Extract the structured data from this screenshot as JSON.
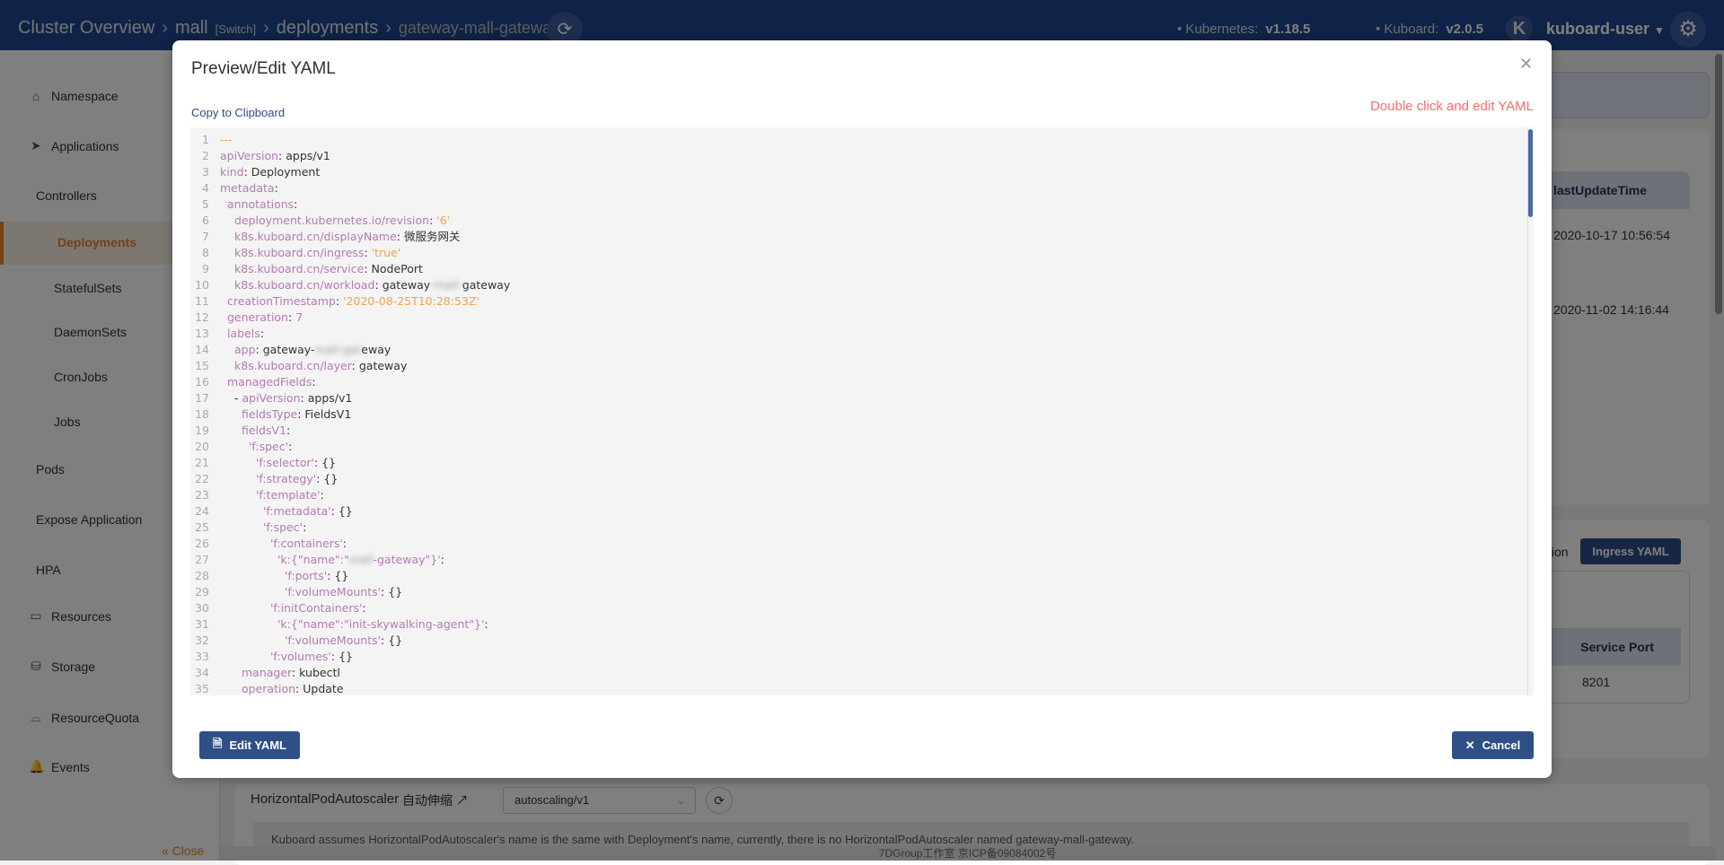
{
  "header": {
    "breadcrumb": [
      "Cluster Overview",
      "mall",
      "[Switch]",
      "deployments",
      "gateway-mall-gateway"
    ],
    "k8s_label": "Kubernetes:",
    "k8s_version": "v1.18.5",
    "kuboard_label": "Kuboard:",
    "kuboard_version": "v2.0.5",
    "avatar": "K",
    "user": "kuboard-user"
  },
  "sidebar": {
    "items": [
      {
        "label": "Namespace",
        "icon": "home"
      },
      {
        "label": "Applications",
        "icon": "paper-plane"
      },
      {
        "label": "Controllers"
      },
      {
        "label": "Deployments",
        "active": true
      },
      {
        "label": "StatefulSets"
      },
      {
        "label": "DaemonSets"
      },
      {
        "label": "CronJobs"
      },
      {
        "label": "Jobs"
      },
      {
        "label": "Pods"
      },
      {
        "label": "Expose Application"
      },
      {
        "label": "HPA"
      },
      {
        "label": "Resources",
        "icon": "layers"
      },
      {
        "label": "Storage",
        "icon": "database"
      },
      {
        "label": "ResourceQuota",
        "icon": "bell-cover"
      },
      {
        "label": "Events",
        "icon": "bell"
      }
    ],
    "close": "« Close"
  },
  "background": {
    "col_last_update": "lastUpdateTime",
    "rows": [
      "2020-10-17 10:56:54",
      "2020-11-02 14:16:44"
    ],
    "partial": "tion",
    "ingress_yaml": "Ingress YAML",
    "col_service_port": "Service Port",
    "service_port": "8201",
    "hpa_label": "HorizontalPodAutoscaler",
    "hpa_cn": "自动伸缩",
    "hpa_select": "autoscaling/v1",
    "hpa_info": "Kuboard assumes HorizontalPodAutoscaler's name is the same with Deployment's name, currently, there is no HorizontalPodAutoscaler named gateway-mall-gateway.",
    "footer": "7DGroup工作室     京ICP备09084002号"
  },
  "modal": {
    "title": "Preview/Edit YAML",
    "copy": "Copy to Clipboard",
    "hint": "Double click and edit YAML",
    "edit_button": "Edit YAML",
    "cancel_button": "Cancel",
    "yaml": [
      {
        "i": 0,
        "raw": "---"
      },
      {
        "i": 0,
        "k": "apiVersion",
        "v": "apps/v1"
      },
      {
        "i": 0,
        "k": "kind",
        "v": "Deployment"
      },
      {
        "i": 0,
        "k": "metadata"
      },
      {
        "i": 2,
        "k": "annotations"
      },
      {
        "i": 4,
        "k": "deployment.kubernetes.io/revision",
        "v": "'6'",
        "s": true
      },
      {
        "i": 4,
        "k": "k8s.kuboard.cn/displayName",
        "v": "微服务网关"
      },
      {
        "i": 4,
        "k": "k8s.kuboard.cn/ingress",
        "v": "'true'",
        "s": true
      },
      {
        "i": 4,
        "k": "k8s.kuboard.cn/service",
        "v": "NodePort"
      },
      {
        "i": 4,
        "k": "k8s.kuboard.cn/workload",
        "v": "gateway-mall-gateway",
        "blur": "-mall-"
      },
      {
        "i": 2,
        "k": "creationTimestamp",
        "v": "'2020-08-25T10:28:53Z'",
        "s": true
      },
      {
        "i": 2,
        "k": "generation",
        "v": "7",
        "n": true
      },
      {
        "i": 2,
        "k": "labels"
      },
      {
        "i": 4,
        "k": "app",
        "v": "gateway-mall-gateway",
        "blur": "mall-gat"
      },
      {
        "i": 4,
        "k": "k8s.kuboard.cn/layer",
        "v": "gateway"
      },
      {
        "i": 2,
        "k": "managedFields"
      },
      {
        "i": 4,
        "d": true,
        "k": "apiVersion",
        "v": "apps/v1"
      },
      {
        "i": 6,
        "k": "fieldsType",
        "v": "FieldsV1"
      },
      {
        "i": 6,
        "k": "fieldsV1"
      },
      {
        "i": 8,
        "k": "'f:spec'"
      },
      {
        "i": 10,
        "k": "'f:selector'",
        "v": "{}"
      },
      {
        "i": 10,
        "k": "'f:strategy'",
        "v": "{}"
      },
      {
        "i": 10,
        "k": "'f:template'"
      },
      {
        "i": 12,
        "k": "'f:metadata'",
        "v": "{}"
      },
      {
        "i": 12,
        "k": "'f:spec'"
      },
      {
        "i": 14,
        "k": "'f:containers'"
      },
      {
        "i": 16,
        "k": "'k:{\"name\":\"mall-gateway\"}'",
        "kblur": "mall"
      },
      {
        "i": 18,
        "k": "'f:ports'",
        "v": "{}"
      },
      {
        "i": 18,
        "k": "'f:volumeMounts'",
        "v": "{}"
      },
      {
        "i": 14,
        "k": "'f:initContainers'"
      },
      {
        "i": 16,
        "k": "'k:{\"name\":\"init-skywalking-agent\"}'"
      },
      {
        "i": 18,
        "k": "'f:volumeMounts'",
        "v": "{}"
      },
      {
        "i": 14,
        "k": "'f:volumes'",
        "v": "{}"
      },
      {
        "i": 6,
        "k": "manager",
        "v": "kubectl"
      },
      {
        "i": 6,
        "k": "operation",
        "v": "Update"
      }
    ]
  },
  "colors": {
    "header": "#1f4690",
    "accent": "#e8832a",
    "primary_button": "#2f4f87",
    "hint": "#f56c6c",
    "yaml_key": "#b47bb5",
    "yaml_string": "#f0a64a"
  }
}
